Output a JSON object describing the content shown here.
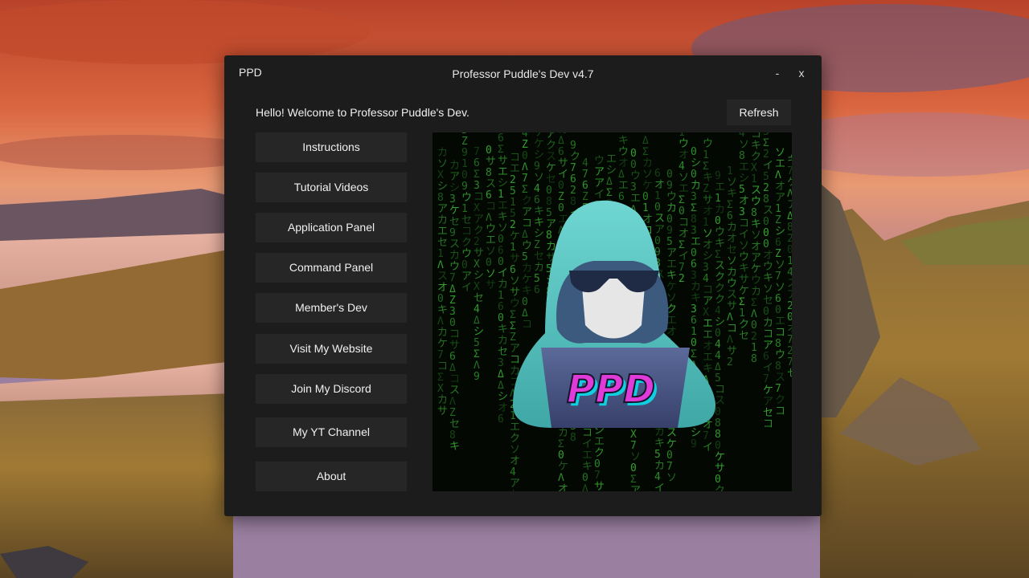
{
  "window": {
    "app_short": "PPD",
    "title": "Professor Puddle's Dev v4.7",
    "minimize_label": "-",
    "close_label": "x"
  },
  "header": {
    "welcome": "Hello! Welcome to Professor Puddle's Dev.",
    "refresh_label": "Refresh"
  },
  "menu": {
    "items": [
      "Instructions",
      "Tutorial Videos",
      "Application Panel",
      "Command Panel",
      "Member's Dev",
      "Visit My Website",
      "Join My Discord",
      "My YT Channel",
      "About"
    ]
  },
  "banner": {
    "logo_text": "PPD",
    "icon": "hooded-hacker-logo",
    "background": "green-matrix-code"
  },
  "colors": {
    "window_bg": "#1c1c1c",
    "button_bg": "#262626",
    "text": "#f0f0f0",
    "matrix_green": "#3fbf3a",
    "hood_teal": "#5ec8c4",
    "logo_magenta": "#e03ad8"
  }
}
